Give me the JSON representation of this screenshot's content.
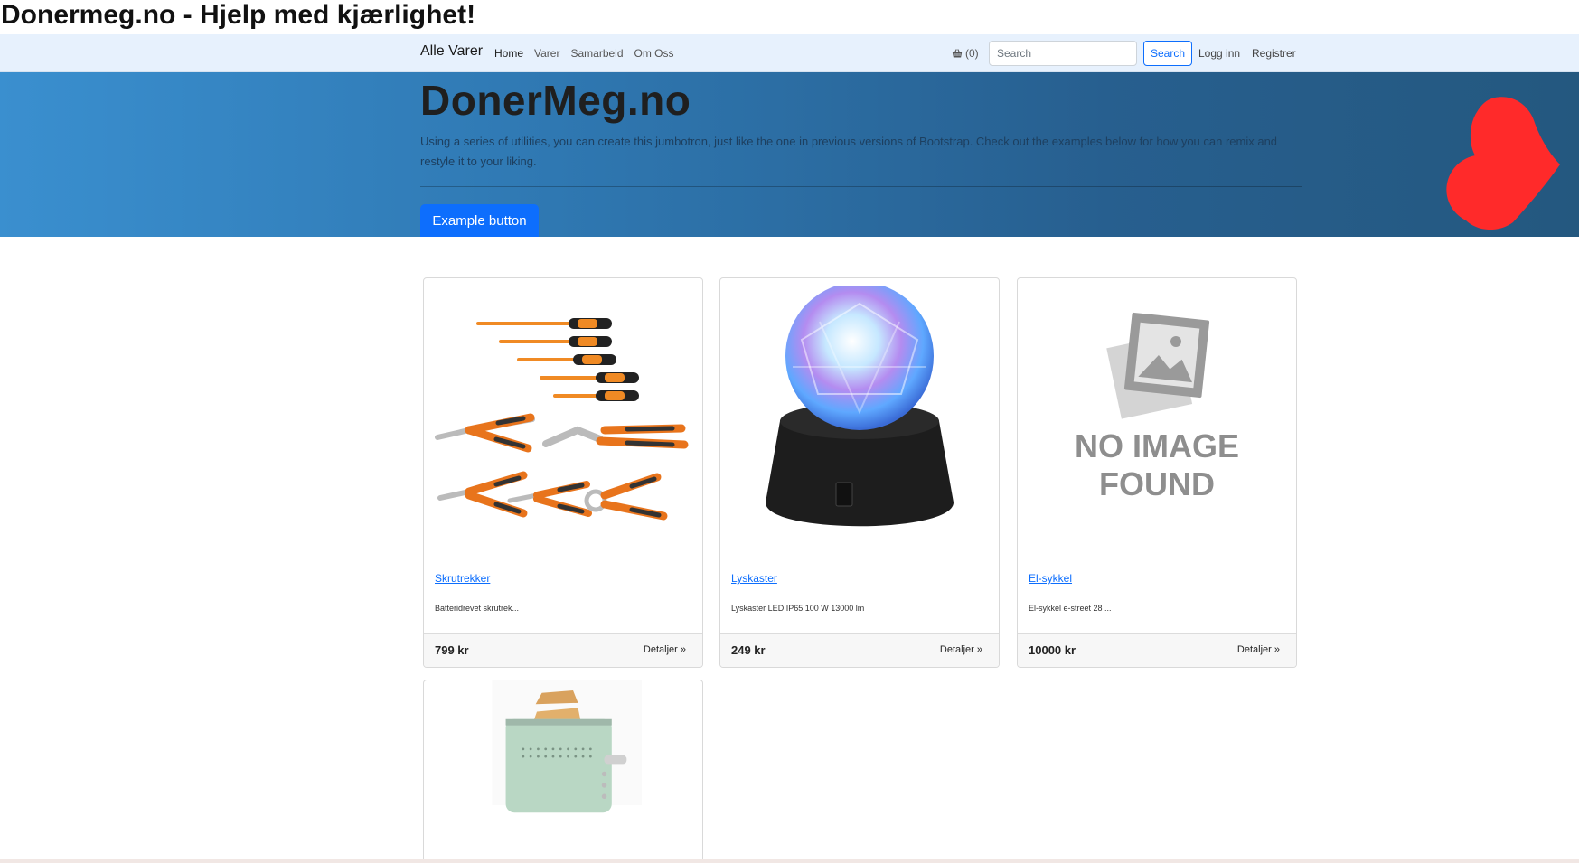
{
  "page": {
    "title": "Donermeg.no - Hjelp med kjærlighet!"
  },
  "navbar": {
    "brand": "Alle Varer",
    "links": [
      "Home",
      "Varer",
      "Samarbeid",
      "Om Oss"
    ],
    "cart_count": "(0)",
    "search_placeholder": "Search",
    "search_button": "Search",
    "login": "Logg inn",
    "register": "Registrer"
  },
  "jumbotron": {
    "heading": "DonerMeg.no",
    "text": "Using a series of utilities, you can create this jumbotron, just like the one in previous versions of Bootstrap. Check out the examples below for how you can remix and restyle it to your liking.",
    "button": "Example button",
    "heart_color": "#ff2a2a"
  },
  "products": [
    {
      "name": "Skrutrekker",
      "desc": "Batteridrevet skrutrek...",
      "price": "799 kr",
      "details": "Detaljer »",
      "image": "tools-image"
    },
    {
      "name": "Lyskaster",
      "desc": "Lyskaster LED IP65 100 W 13000 lm",
      "price": "249 kr",
      "details": "Detaljer »",
      "image": "disco-ball-image"
    },
    {
      "name": "El-sykkel",
      "desc": "El-sykkel e-street 28 ...",
      "price": "10000 kr",
      "details": "Detaljer »",
      "image": "no-image-placeholder",
      "placeholder_line1": "NO IMAGE",
      "placeholder_line2": "FOUND"
    },
    {
      "name": "",
      "desc": "",
      "price": "",
      "details": "",
      "image": "toaster-image"
    }
  ],
  "colors": {
    "primary": "#0d6efd",
    "navbar_bg": "#e7f1fd",
    "jumbo_left": "#3a8fcf",
    "jumbo_right": "#24587f"
  }
}
